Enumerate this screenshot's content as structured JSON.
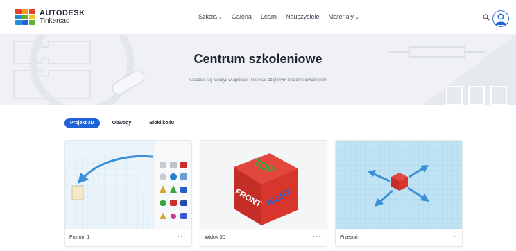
{
  "brand": {
    "name_line1": "AUTODESK",
    "name_line2": "Tinkercad",
    "logo_colors": [
      "#e1412b",
      "#f39a1e",
      "#e1412b",
      "#1f8fd6",
      "#5bb42f",
      "#f7c31a",
      "#1f8fd6",
      "#1f63d8",
      "#5bb42f"
    ]
  },
  "nav": {
    "items": [
      {
        "label": "Szkoła",
        "has_dropdown": true
      },
      {
        "label": "Galeria",
        "has_dropdown": false
      },
      {
        "label": "Learn",
        "has_dropdown": false
      },
      {
        "label": "Nauczyciele",
        "has_dropdown": false
      },
      {
        "label": "Materiały",
        "has_dropdown": true
      }
    ],
    "chevron": "⌄"
  },
  "hero": {
    "title": "Centrum szkoleniowe",
    "subtitle": "Nauczcie się tworzyć w aplikacji Tinkercad dzięki tym lekcjom i ćwiczeniom!"
  },
  "tabs": {
    "items": [
      {
        "label": "Projekt 3D",
        "active": true
      },
      {
        "label": "Obwody",
        "active": false
      },
      {
        "label": "Bloki kodu",
        "active": false
      }
    ]
  },
  "cards": [
    {
      "title": "Poziom 1",
      "more": "···"
    },
    {
      "title": "Widok 3D",
      "more": "···"
    },
    {
      "title": "Przesuń",
      "more": "···"
    }
  ],
  "cube_labels": {
    "top": "TOP",
    "front": "FRONT",
    "right": "RIGHT"
  },
  "colors": {
    "accent": "#1f63d8",
    "hero_bg": "#eff1f4",
    "grid_blue": "#bfe3f4",
    "cube_red": "#d8332a",
    "cube_text_green": "#3aa83a",
    "arrow_blue": "#3a8fd6"
  },
  "icons": {
    "search": "search-icon",
    "avatar": "user-avatar-icon"
  }
}
